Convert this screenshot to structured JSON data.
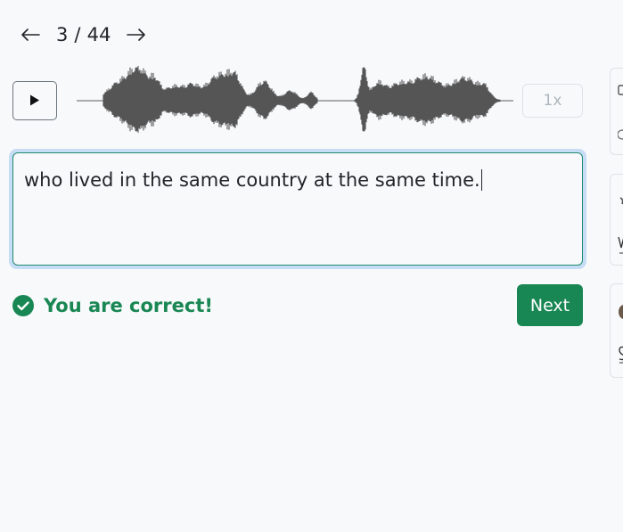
{
  "pager": {
    "current": "3",
    "total": "44",
    "label": "3 / 44",
    "prev_icon": "arrow-left-icon",
    "next_icon": "arrow-right-icon"
  },
  "audio": {
    "play_icon": "play-icon",
    "speed_label": "1x"
  },
  "answer": {
    "value": "who lived in the same country at the same time."
  },
  "feedback": {
    "icon": "check-circle-icon",
    "text": "You are correct!",
    "color": "#198754"
  },
  "actions": {
    "next_label": "Next"
  },
  "colors": {
    "accent_green": "#198754",
    "focus_ring": "#c7dcf5",
    "waveform": "#555555"
  }
}
